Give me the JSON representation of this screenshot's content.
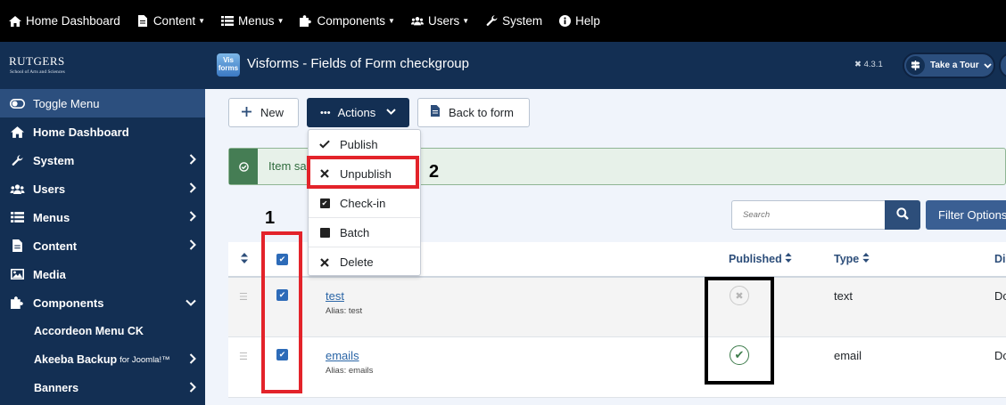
{
  "topbar": {
    "items": [
      {
        "label": "Home Dashboard",
        "icon": "home-icon",
        "caret": false
      },
      {
        "label": "Content",
        "icon": "file-icon",
        "caret": true
      },
      {
        "label": "Menus",
        "icon": "list-icon",
        "caret": true
      },
      {
        "label": "Components",
        "icon": "puzzle-icon",
        "caret": true
      },
      {
        "label": "Users",
        "icon": "users-icon",
        "caret": true
      },
      {
        "label": "System",
        "icon": "wrench-icon",
        "caret": false
      },
      {
        "label": "Help",
        "icon": "info-icon",
        "caret": false
      }
    ]
  },
  "sidebar": {
    "logo_name": "RUTGERS",
    "logo_sub": "School of Arts and Sciences",
    "toggle_label": "Toggle Menu",
    "items": [
      {
        "label": "Home Dashboard",
        "icon": "home-icon"
      },
      {
        "label": "System",
        "icon": "wrench-icon"
      },
      {
        "label": "Users",
        "icon": "users-icon"
      },
      {
        "label": "Menus",
        "icon": "list-icon"
      },
      {
        "label": "Content",
        "icon": "file-icon"
      },
      {
        "label": "Media",
        "icon": "image-icon"
      },
      {
        "label": "Components",
        "icon": "puzzle-icon"
      }
    ],
    "subitems": [
      {
        "label": "Accordeon Menu CK"
      },
      {
        "label": "Akeeba Backup",
        "small": "for Joomla!™"
      },
      {
        "label": "Banners"
      }
    ]
  },
  "header": {
    "logo_text_top": "Vis",
    "logo_text_bottom": "forms",
    "title": "Visforms - Fields of Form checkgroup",
    "version": "4.3.1",
    "tour_label": "Take a Tour"
  },
  "toolbar": {
    "new_label": "New",
    "actions_label": "Actions",
    "back_label": "Back to form"
  },
  "alert": {
    "message": "Item sa"
  },
  "search": {
    "placeholder": "Search",
    "filter_label": "Filter Options"
  },
  "dropdown": {
    "items": [
      "Publish",
      "Unpublish",
      "Check-in",
      "Batch",
      "Delete"
    ]
  },
  "table": {
    "headers": {
      "published": "Published",
      "type": "Type",
      "clipped": "Di"
    },
    "rows": [
      {
        "title": "test",
        "alias": "Alias: test",
        "type": "text",
        "published": false,
        "clipped": "Do"
      },
      {
        "title": "emails",
        "alias": "Alias: emails",
        "type": "email",
        "published": true,
        "clipped": "Do"
      }
    ]
  },
  "annotations": {
    "label_1": "1",
    "label_2": "2"
  },
  "colors": {
    "navy": "#132f53",
    "accent_blue": "#2d6bb8",
    "success_green": "#3c7b4a",
    "annotation_red": "#e3232a"
  }
}
